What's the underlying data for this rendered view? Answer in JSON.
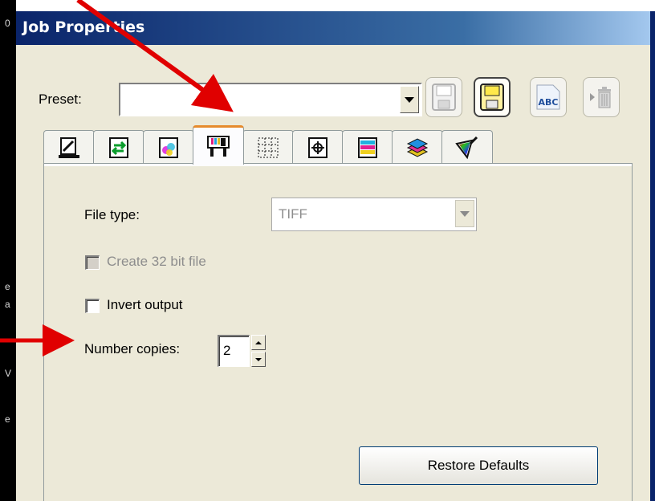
{
  "window": {
    "title": "Job Properties"
  },
  "left_strip": {
    "glyphs": [
      "0",
      "e",
      "a",
      "V",
      "e"
    ]
  },
  "preset": {
    "label": "Preset:",
    "value": ""
  },
  "toolbar": {
    "abc_label": "ABC"
  },
  "tabs": [
    "layout-icon",
    "import-icon",
    "color-icon",
    "printer-icon",
    "grid-icon",
    "crop-mark-icon",
    "color-bars-icon",
    "layers-icon",
    "profile-picker-icon"
  ],
  "panel": {
    "file_type_label": "File type:",
    "file_type_value": "TIFF",
    "create32_label": "Create 32 bit file",
    "create32_checked": false,
    "invert_label": "Invert output",
    "invert_checked": false,
    "copies_label": "Number copies:",
    "copies_value": "2",
    "restore_label": "Restore Defaults"
  },
  "colors": {
    "annotation": "#e00000",
    "title_bar": "#0a246a",
    "active_tab_accent": "#e68b2c"
  }
}
